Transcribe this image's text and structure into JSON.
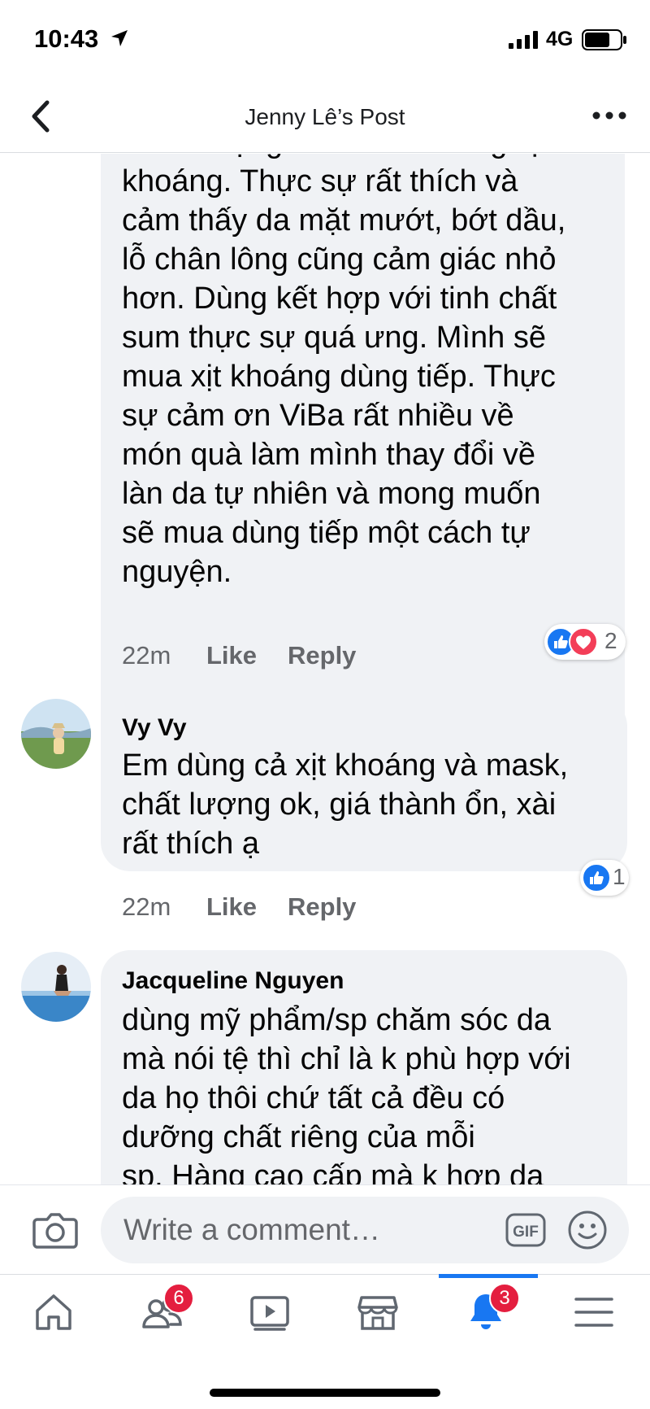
{
  "status_bar": {
    "time": "10:43",
    "network": "4G"
  },
  "header": {
    "title": "Jenny Lê’s Post"
  },
  "comments": [
    {
      "partial_top_line": "của lời tặng. Mình mới dùng xịt",
      "text_lines": [
        "khoáng. Thực sự rất thích và",
        "cảm thấy da mặt mướt, bớt dầu,",
        "lỗ chân lông cũng cảm giác nhỏ",
        "hơn. Dùng kết hợp với tinh chất",
        "sum thực sự quá ưng. Mình sẽ",
        "mua xịt khoáng dùng tiếp. Thực",
        "sự cảm ơn ViBa rất nhiều về",
        "món quà làm mình thay đổi về",
        "làn da tự nhiên và mong muốn",
        "sẽ mua dùng tiếp một cách tự",
        "nguyện."
      ],
      "time": "22m",
      "like_label": "Like",
      "reply_label": "Reply",
      "reactions": [
        "like",
        "love"
      ],
      "reaction_count": "2"
    },
    {
      "author": "Vy Vy",
      "text_lines": [
        "Em dùng cả xịt khoáng và mask,",
        "chất lượng ok, giá thành ổn, xài",
        "rất thích ạ"
      ],
      "time": "22m",
      "like_label": "Like",
      "reply_label": "Reply",
      "reactions": [
        "like"
      ],
      "reaction_count": "1"
    },
    {
      "author": "Jacqueline Nguyen",
      "text_lines": [
        "dùng mỹ phẩm/sp chăm sóc da",
        "mà nói tệ thì chỉ là k phù hợp với",
        "da họ thôi chứ tất cả đều có",
        "dưỡng chất riêng của mỗi",
        "sp. Hàng cao cấp mà k hợp da"
      ]
    }
  ],
  "composer": {
    "placeholder": "Write a comment…",
    "gif_label": "GIF"
  },
  "tabbar": {
    "tabs": [
      "home",
      "friends",
      "watch",
      "marketplace",
      "notifications",
      "menu"
    ],
    "friends_badge": "6",
    "notifications_badge": "3",
    "active_tab": "notifications"
  },
  "colors": {
    "accent": "#1877f2",
    "badge": "#e41e3f",
    "bubble": "#f0f2f5",
    "love": "#f33e58"
  }
}
